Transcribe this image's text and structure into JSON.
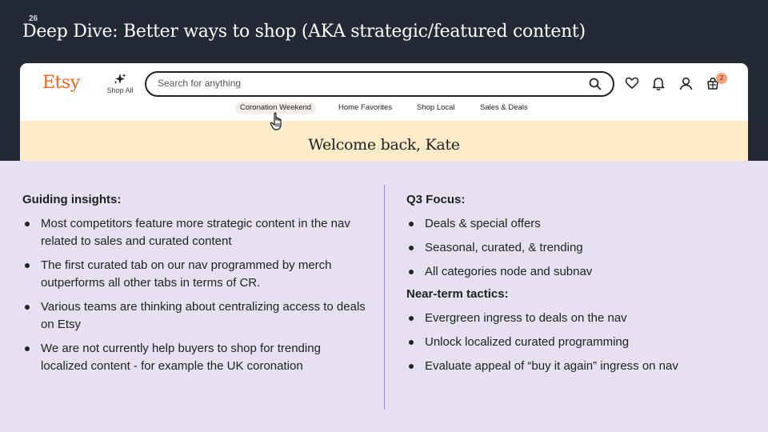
{
  "slide": {
    "number": "26",
    "title": "Deep Dive: Better ways to shop (AKA strategic/featured content)"
  },
  "etsy": {
    "logo": "Etsy",
    "shop_all_label": "Shop All",
    "search_placeholder": "Search for anything",
    "cart_count": "2",
    "icons": [
      "search-icon",
      "heart-icon",
      "bell-icon",
      "user-icon",
      "cart-icon",
      "sparkle-icon",
      "hand-cursor-icon"
    ],
    "tabs": [
      {
        "label": "Coronation Weekend",
        "active": true
      },
      {
        "label": "Home Favorites",
        "active": false
      },
      {
        "label": "Shop Local",
        "active": false
      },
      {
        "label": "Sales & Deals",
        "active": false
      }
    ],
    "welcome": "Welcome back, Kate",
    "colors": {
      "brand": "#f1641e",
      "banner": "#fdebc9"
    }
  },
  "insights": {
    "heading": "Guiding insights:",
    "items": [
      "Most competitors feature more strategic content in the nav related to sales and curated content",
      "The first curated tab on our nav programmed by merch outperforms all other tabs in terms of CR.",
      "Various teams are thinking about centralizing access to deals on Etsy",
      "We are not currently help buyers to shop for trending localized content - for example the UK coronation"
    ]
  },
  "q3": {
    "heading": "Q3 Focus:",
    "items": [
      "Deals & special offers",
      "Seasonal, curated, & trending",
      "All categories node and subnav"
    ]
  },
  "tactics": {
    "heading": "Near-term tactics:",
    "items": [
      "Evergreen ingress to deals on the nav",
      "Unlock localized curated programming",
      "Evaluate appeal of “buy it again” ingress on nav"
    ]
  },
  "colors": {
    "slide_dark": "#232a35",
    "slide_light": "#e6e0f1",
    "divider": "#9b93c4"
  }
}
